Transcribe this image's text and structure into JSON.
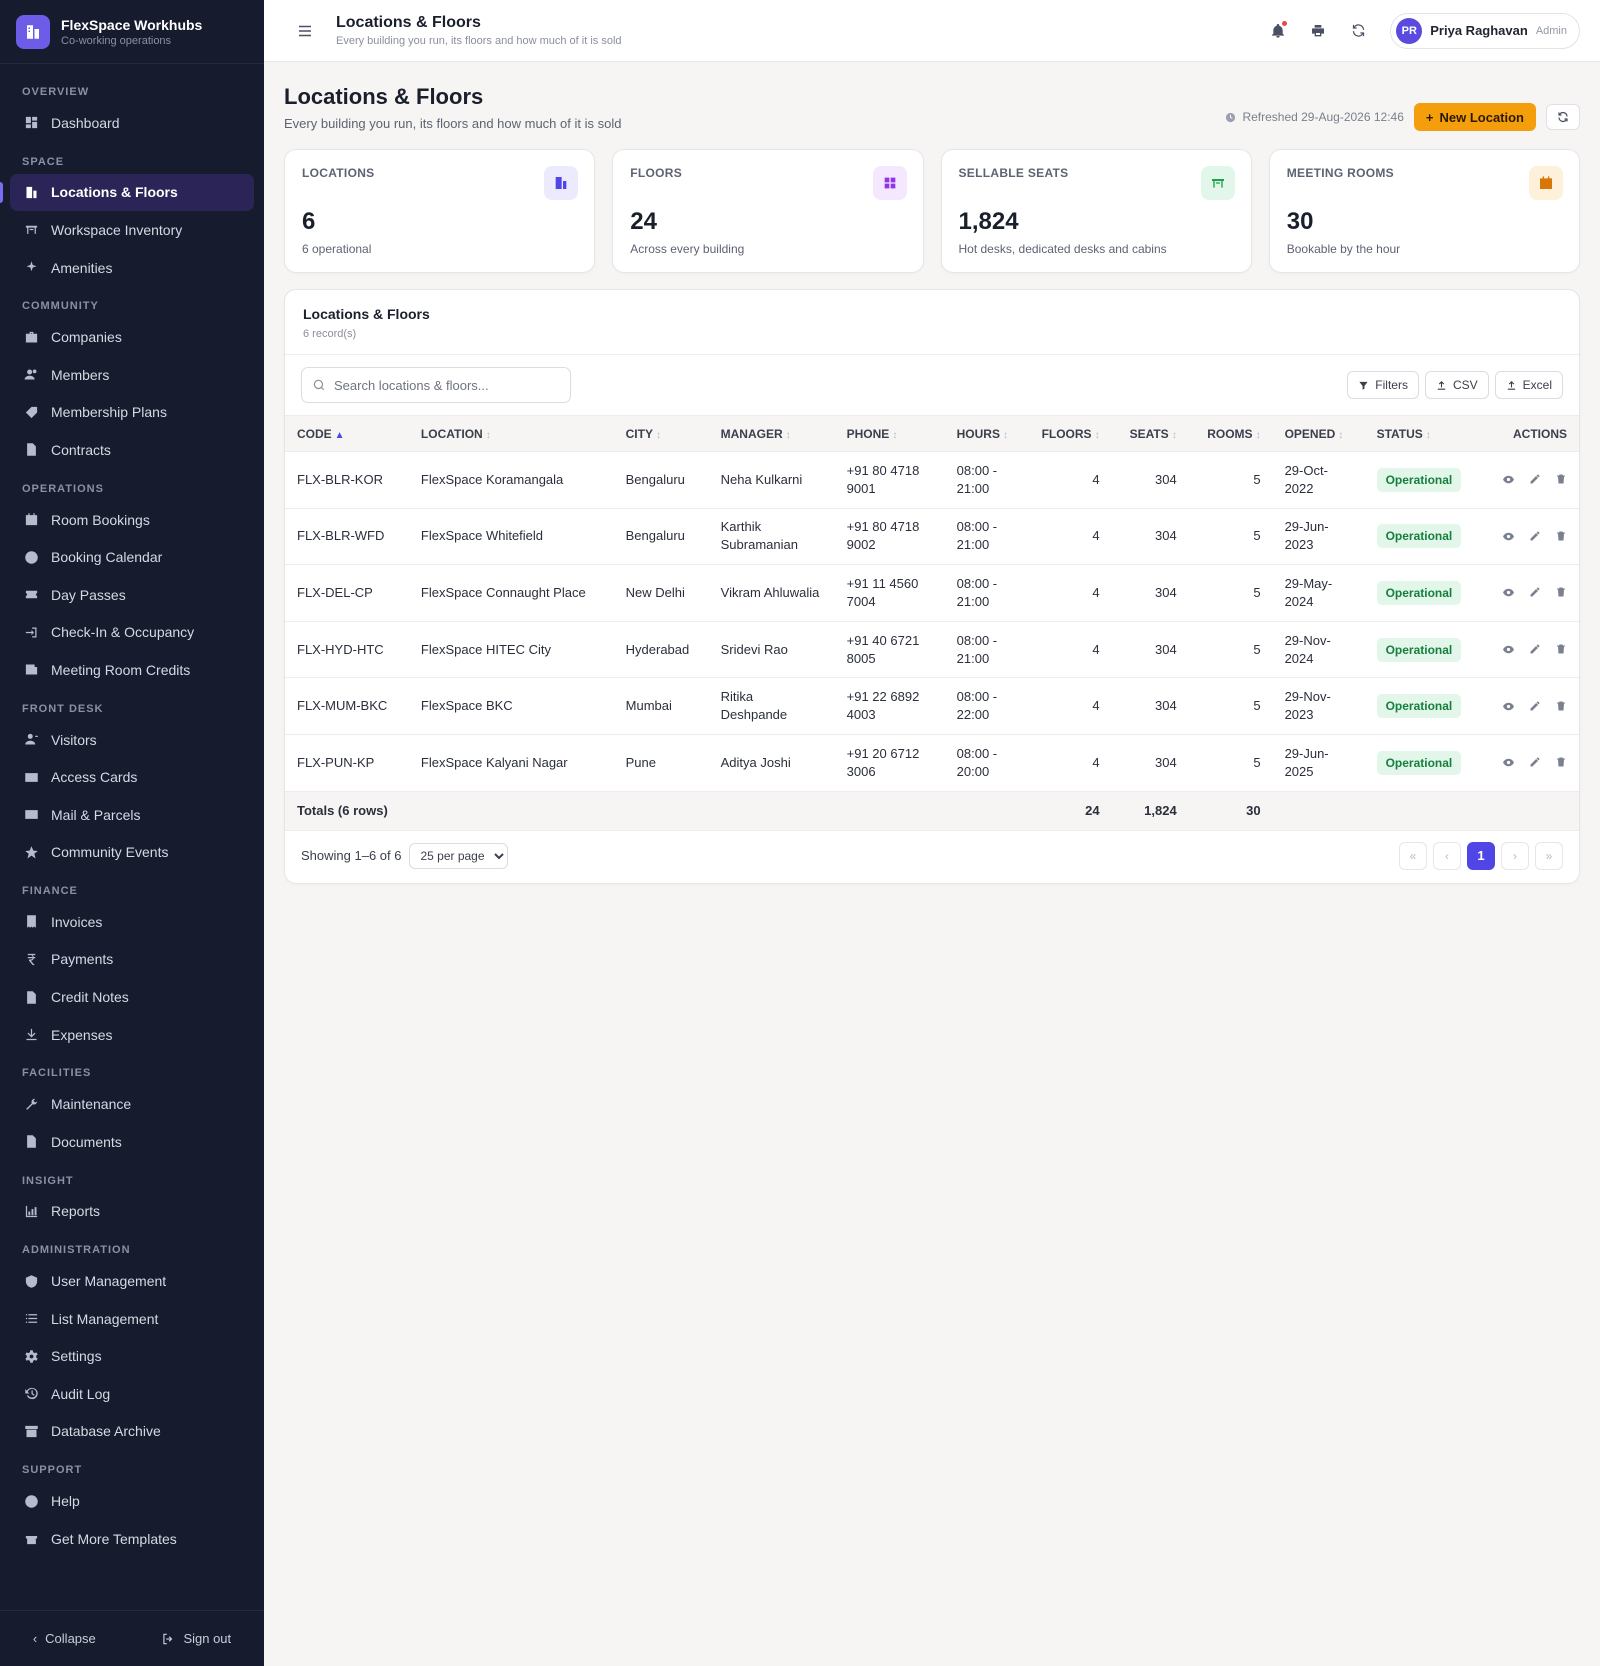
{
  "brand": {
    "name": "FlexSpace Workhubs",
    "tagline": "Co-working operations"
  },
  "sidebar": {
    "sections": [
      {
        "title": "OVERVIEW",
        "items": [
          {
            "label": "Dashboard",
            "icon": "dashboard-icon"
          }
        ]
      },
      {
        "title": "SPACE",
        "items": [
          {
            "label": "Locations & Floors",
            "icon": "building-icon",
            "active": true
          },
          {
            "label": "Workspace Inventory",
            "icon": "desk-icon"
          },
          {
            "label": "Amenities",
            "icon": "sparkle-icon"
          }
        ]
      },
      {
        "title": "COMMUNITY",
        "items": [
          {
            "label": "Companies",
            "icon": "briefcase-icon"
          },
          {
            "label": "Members",
            "icon": "users-icon"
          },
          {
            "label": "Membership Plans",
            "icon": "tag-icon"
          },
          {
            "label": "Contracts",
            "icon": "file-icon"
          }
        ]
      },
      {
        "title": "OPERATIONS",
        "items": [
          {
            "label": "Room Bookings",
            "icon": "calendar-icon"
          },
          {
            "label": "Booking Calendar",
            "icon": "clock-icon"
          },
          {
            "label": "Day Passes",
            "icon": "ticket-icon"
          },
          {
            "label": "Check-In & Occupancy",
            "icon": "sign-in-icon"
          },
          {
            "label": "Meeting Room Credits",
            "icon": "credit-icon"
          }
        ]
      },
      {
        "title": "FRONT DESK",
        "items": [
          {
            "label": "Visitors",
            "icon": "visitor-icon"
          },
          {
            "label": "Access Cards",
            "icon": "card-icon"
          },
          {
            "label": "Mail & Parcels",
            "icon": "mail-icon"
          },
          {
            "label": "Community Events",
            "icon": "star-icon"
          }
        ]
      },
      {
        "title": "FINANCE",
        "items": [
          {
            "label": "Invoices",
            "icon": "invoice-icon"
          },
          {
            "label": "Payments",
            "icon": "rupee-icon"
          },
          {
            "label": "Credit Notes",
            "icon": "note-icon"
          },
          {
            "label": "Expenses",
            "icon": "download-icon"
          }
        ]
      },
      {
        "title": "FACILITIES",
        "items": [
          {
            "label": "Maintenance",
            "icon": "wrench-icon"
          },
          {
            "label": "Documents",
            "icon": "document-icon"
          }
        ]
      },
      {
        "title": "INSIGHT",
        "items": [
          {
            "label": "Reports",
            "icon": "chart-icon"
          }
        ]
      },
      {
        "title": "ADMINISTRATION",
        "items": [
          {
            "label": "User Management",
            "icon": "shield-icon"
          },
          {
            "label": "List Management",
            "icon": "list-icon"
          },
          {
            "label": "Settings",
            "icon": "gear-icon"
          },
          {
            "label": "Audit Log",
            "icon": "history-icon"
          },
          {
            "label": "Database Archive",
            "icon": "archive-icon"
          }
        ]
      },
      {
        "title": "SUPPORT",
        "items": [
          {
            "label": "Help",
            "icon": "help-icon"
          },
          {
            "label": "Get More Templates",
            "icon": "gift-icon"
          }
        ]
      }
    ],
    "collapse_label": "Collapse",
    "signout_label": "Sign out"
  },
  "topbar": {
    "title": "Locations & Floors",
    "subtitle": "Every building you run, its floors and how much of it is sold",
    "user_initials": "PR",
    "user_name": "Priya Raghavan",
    "user_role": "Admin"
  },
  "page": {
    "title": "Locations & Floors",
    "subtitle": "Every building you run, its floors and how much of it is sold",
    "refreshed": "Refreshed 29-Aug-2026 12:46",
    "new_button": "New Location"
  },
  "stats": [
    {
      "label": "LOCATIONS",
      "value": "6",
      "note": "6 operational",
      "icon": "building-icon",
      "color": "#4f46e5",
      "bg": "#ecebfd"
    },
    {
      "label": "FLOORS",
      "value": "24",
      "note": "Across every building",
      "icon": "grid-icon",
      "color": "#9333ea",
      "bg": "#f3e8fd"
    },
    {
      "label": "SELLABLE SEATS",
      "value": "1,824",
      "note": "Hot desks, dedicated desks and cabins",
      "icon": "desk-icon",
      "color": "#16a34a",
      "bg": "#e3f6ea"
    },
    {
      "label": "MEETING ROOMS",
      "value": "30",
      "note": "Bookable by the hour",
      "icon": "calendar-icon",
      "color": "#d97706",
      "bg": "#fdf1dc"
    }
  ],
  "table": {
    "title": "Locations & Floors",
    "records": "6 record(s)",
    "search_placeholder": "Search locations & floors...",
    "filters_label": "Filters",
    "csv_label": "CSV",
    "excel_label": "Excel",
    "columns": [
      "CODE",
      "LOCATION",
      "CITY",
      "MANAGER",
      "PHONE",
      "HOURS",
      "FLOORS",
      "SEATS",
      "ROOMS",
      "OPENED",
      "STATUS",
      "ACTIONS"
    ],
    "rows": [
      {
        "code": "FLX-BLR-KOR",
        "location": "FlexSpace Koramangala",
        "city": "Bengaluru",
        "manager": "Neha Kulkarni",
        "phone": "+91 80 4718 9001",
        "hours": "08:00 - 21:00",
        "floors": "4",
        "seats": "304",
        "rooms": "5",
        "opened": "29-Oct-2022",
        "status": "Operational"
      },
      {
        "code": "FLX-BLR-WFD",
        "location": "FlexSpace Whitefield",
        "city": "Bengaluru",
        "manager": "Karthik Subramanian",
        "phone": "+91 80 4718 9002",
        "hours": "08:00 - 21:00",
        "floors": "4",
        "seats": "304",
        "rooms": "5",
        "opened": "29-Jun-2023",
        "status": "Operational"
      },
      {
        "code": "FLX-DEL-CP",
        "location": "FlexSpace Connaught Place",
        "city": "New Delhi",
        "manager": "Vikram Ahluwalia",
        "phone": "+91 11 4560 7004",
        "hours": "08:00 - 21:00",
        "floors": "4",
        "seats": "304",
        "rooms": "5",
        "opened": "29-May-2024",
        "status": "Operational"
      },
      {
        "code": "FLX-HYD-HTC",
        "location": "FlexSpace HITEC City",
        "city": "Hyderabad",
        "manager": "Sridevi Rao",
        "phone": "+91 40 6721 8005",
        "hours": "08:00 - 21:00",
        "floors": "4",
        "seats": "304",
        "rooms": "5",
        "opened": "29-Nov-2024",
        "status": "Operational"
      },
      {
        "code": "FLX-MUM-BKC",
        "location": "FlexSpace BKC",
        "city": "Mumbai",
        "manager": "Ritika Deshpande",
        "phone": "+91 22 6892 4003",
        "hours": "08:00 - 22:00",
        "floors": "4",
        "seats": "304",
        "rooms": "5",
        "opened": "29-Nov-2023",
        "status": "Operational"
      },
      {
        "code": "FLX-PUN-KP",
        "location": "FlexSpace Kalyani Nagar",
        "city": "Pune",
        "manager": "Aditya Joshi",
        "phone": "+91 20 6712 3006",
        "hours": "08:00 - 20:00",
        "floors": "4",
        "seats": "304",
        "rooms": "5",
        "opened": "29-Jun-2025",
        "status": "Operational"
      }
    ],
    "totals": {
      "label": "Totals (6 rows)",
      "floors": "24",
      "seats": "1,824",
      "rooms": "30"
    },
    "showing": "Showing 1–6 of 6",
    "per_page": "25 per page",
    "current_page": "1"
  }
}
